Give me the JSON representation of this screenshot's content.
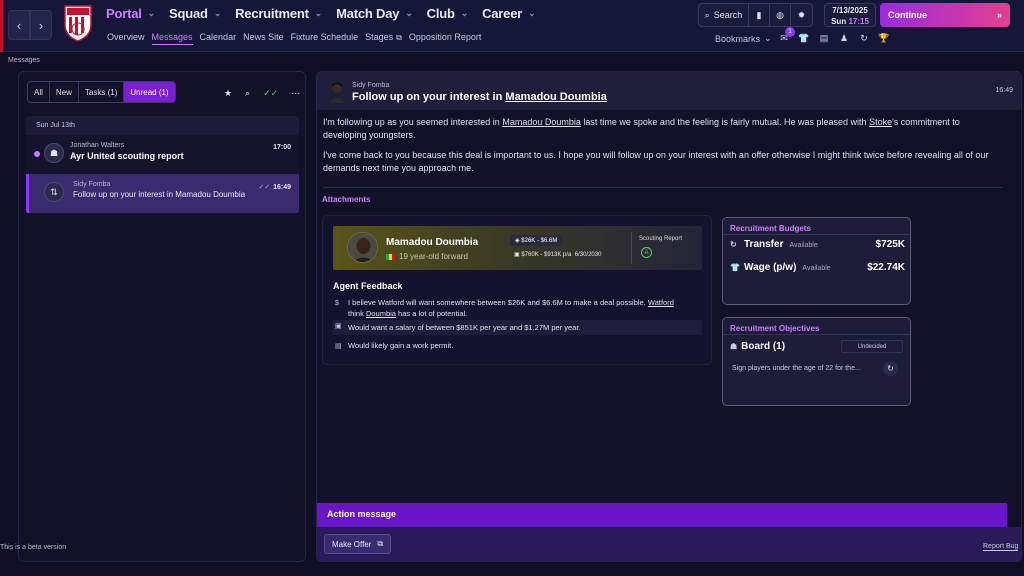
{
  "nav": {
    "back_icon": "chevron-left-icon",
    "forward_icon": "chevron-right-icon",
    "crest_text": "STOKE",
    "menu": [
      {
        "label": "Portal"
      },
      {
        "label": "Squad"
      },
      {
        "label": "Recruitment"
      },
      {
        "label": "Match Day"
      },
      {
        "label": "Club"
      },
      {
        "label": "Career"
      }
    ],
    "submenu": [
      "Overview",
      "Messages",
      "Calendar",
      "News Site",
      "Fixture Schedule",
      "Stages",
      "Opposition Report"
    ],
    "search_label": "Search",
    "date": "7/13/2025",
    "day_time": "Sun",
    "time": "17:15",
    "continue_label": "Continue",
    "bookmarks_label": "Bookmarks",
    "inbox_badge": "1"
  },
  "breadcrumb": "Messages",
  "left": {
    "filters": [
      "All",
      "New",
      "Tasks (1)",
      "Unread (1)"
    ],
    "date_header": "Sun Jul 13th",
    "messages": [
      {
        "sender": "Jonathan Walters",
        "subject": "Ayr United scouting report",
        "time": "17:00"
      },
      {
        "sender": "Sidy Fomba",
        "subject": "Follow up on your interest in Mamadou Doumbia",
        "time": "16:49"
      }
    ],
    "beta_text": "This is a beta version"
  },
  "message": {
    "sender": "Sidy Fomba",
    "subject_prefix": "Follow up on your interest in",
    "subject_player": "Mamadou Doumbia",
    "time": "16:49",
    "p1_a": "I'm following up as you seemed interested in",
    "p1_player": "Mamadou Doumbia",
    "p1_b": "last time we spoke and the feeling is fairly mutual. He was pleased with",
    "p1_club": "Stoke",
    "p1_c": "'s commitment to developing youngsters.",
    "p2": "I've come back to you because this deal is important to us. I hope you will follow up on your interest with an offer otherwise I might think twice before revealing all of our demands next time you approach me.",
    "attachments_label": "Attachments"
  },
  "player": {
    "name": "Mamadou Doumbia",
    "description": "19 year-old forward",
    "value_range": "$26K - $6.6M",
    "wage_range": "$760K - $913K p/a",
    "contract_end": "6/30/2030",
    "scouting_label": "Scouting Report",
    "scout_grade": "A"
  },
  "feedback": {
    "title": "Agent Feedback",
    "l1_a": "I believe Watford will want somewhere between $26K and $6.6M to make a deal possible.",
    "l1_club": "Watford",
    "l1_b": "think",
    "l1_player": "Doumbia",
    "l1_c": "has a lot of potential.",
    "l2": "Would want a salary of between $851K per year and $1.27M per year.",
    "l3": "Would likely gain a work permit."
  },
  "budgets": {
    "title": "Recruitment Budgets",
    "transfer_label": "Transfer",
    "transfer_avail": "Available",
    "transfer_amount": "$725K",
    "wage_label": "Wage (p/w)",
    "wage_avail": "Available",
    "wage_amount": "$22.74K"
  },
  "objectives": {
    "title": "Recruitment Objectives",
    "board_label": "Board (1)",
    "status": "Undecided",
    "text": "Sign players under the age of 22 for the..."
  },
  "action": {
    "title": "Action message",
    "button": "Make Offer"
  },
  "report_bug": "Report Bug",
  "colors": {
    "accent": "#d07bff",
    "primary": "#7a1fd6",
    "club": "#c8102e"
  }
}
